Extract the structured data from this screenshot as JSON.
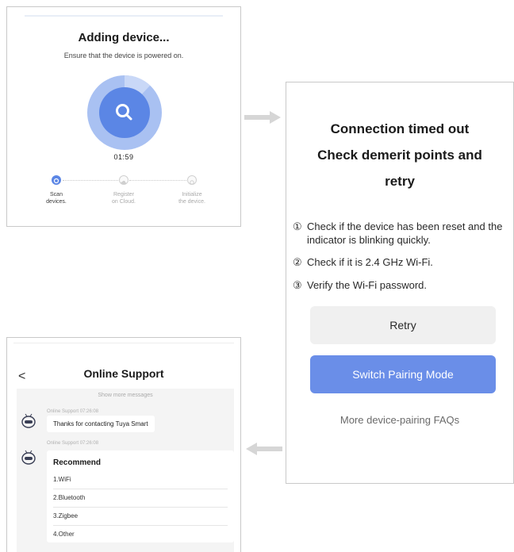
{
  "adding": {
    "title": "Adding device...",
    "subtitle": "Ensure that the device is powered on.",
    "timer": "01:59",
    "search_icon": "search-icon",
    "steps": [
      {
        "label": "Scan\ndevices.",
        "active": true
      },
      {
        "label": "Register\non Cloud.",
        "active": false
      },
      {
        "label": "Initialize\nthe device.",
        "active": false
      }
    ],
    "progress_fraction": 0.12,
    "accent": "#5b86e5"
  },
  "timeout": {
    "heading_lines": [
      "Connection timed out",
      "Check demerit points and",
      "retry"
    ],
    "tips": [
      {
        "num": "①",
        "text": "Check if the device has been reset and the indicator is blinking quickly."
      },
      {
        "num": "②",
        "text": "Check if it is 2.4 GHz Wi-Fi."
      },
      {
        "num": "③",
        "text": "Verify the Wi-Fi password."
      }
    ],
    "retry_label": "Retry",
    "switch_label": "Switch Pairing Mode",
    "faq_label": "More device-pairing FAQs",
    "primary_color": "#6a8ee8"
  },
  "support": {
    "back_glyph": "<",
    "title": "Online Support",
    "show_more": "Show more messages",
    "messages": [
      {
        "sender": "Online Support",
        "time": "07:26:08",
        "text": "Thanks for contacting Tuya Smart"
      },
      {
        "sender": "Online Support",
        "time": "07:26:08"
      }
    ],
    "recommend_title": "Recommend",
    "recommend_items": [
      "1.WiFi",
      "2.Bluetooth",
      "3.Zigbee",
      "4.Other"
    ]
  }
}
